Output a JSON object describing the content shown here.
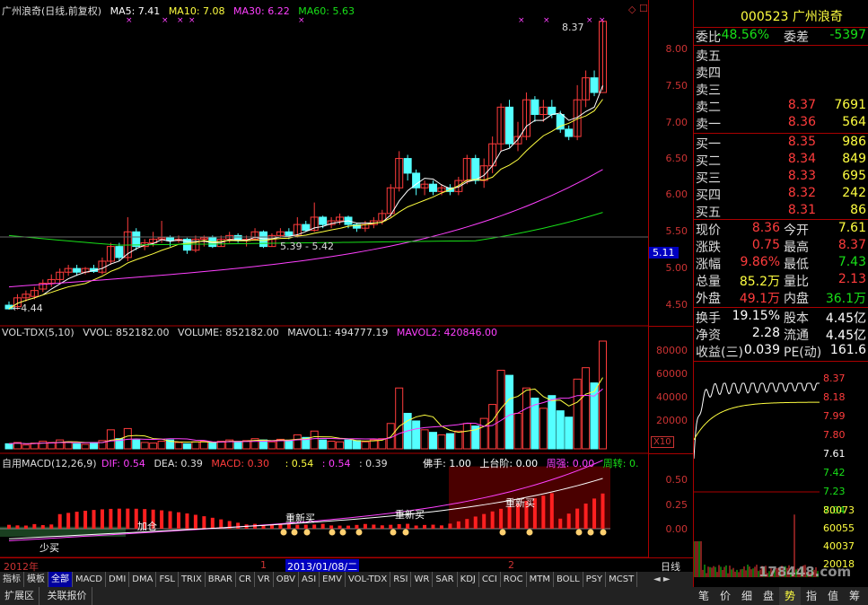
{
  "main_header": {
    "title": "广州浪奇(日线,前复权)",
    "ma5": "MA5: 7.41",
    "ma10": "MA10: 7.08",
    "ma30": "MA30: 6.22",
    "ma60": "MA60: 5.63",
    "high_label": "8.37",
    "low_label": "4.44",
    "mid_label": "5.39 - 5.42",
    "current_tag": "5.11"
  },
  "vol_header": {
    "name": "VOL-TDX(5,10)",
    "vvol": "VVOL: 852182.00",
    "volume": "VOLUME: 852182.00",
    "mavol1": "MAVOL1: 494777.19",
    "mavol2": "MAVOL2: 420846.00"
  },
  "macd_header": {
    "name": "自用MACD(12,26,9)",
    "dif": "DIF: 0.54",
    "dea": "DEA: 0.39",
    "macd": "MACD: 0.30",
    "v1": ": 0.54",
    "v2": ": 0.54",
    "v3": ": 0.39",
    "foshou": "佛手: 1.00",
    "shangtai": "上台阶: 0.00",
    "zhouqiang": "周强: 0.00",
    "zhouzhuan": "周转: 0."
  },
  "annotations": {
    "shaomai": "少买",
    "jiacang": "加仓",
    "chongxin1": "重新买",
    "chongxin2": "重新买",
    "chongxin3": "重新买",
    "x10": "X10"
  },
  "price_axis": [
    "8.00",
    "7.50",
    "7.00",
    "6.50",
    "6.00",
    "5.50",
    "5.00",
    "4.50"
  ],
  "vol_axis": [
    "80000",
    "60000",
    "40000",
    "20000"
  ],
  "macd_axis": [
    "0.50",
    "0.25",
    "0.00"
  ],
  "time_axis": {
    "year": "2012年",
    "m1": "1",
    "date": "2013/01/08/二",
    "m2": "2",
    "period": "日线"
  },
  "quote": {
    "code": "000523",
    "name": "广州浪奇",
    "weibi_label": "委比",
    "weibi": "-48.56%",
    "weicha_label": "委差",
    "weicha": "-5397",
    "sell": [
      {
        "label": "卖五",
        "price": "",
        "vol": ""
      },
      {
        "label": "卖四",
        "price": "",
        "vol": ""
      },
      {
        "label": "卖三",
        "price": "",
        "vol": ""
      },
      {
        "label": "卖二",
        "price": "8.37",
        "vol": "7691"
      },
      {
        "label": "卖一",
        "price": "8.36",
        "vol": "564"
      }
    ],
    "buy": [
      {
        "label": "买一",
        "price": "8.35",
        "vol": "986"
      },
      {
        "label": "买二",
        "price": "8.34",
        "vol": "849"
      },
      {
        "label": "买三",
        "price": "8.33",
        "vol": "695"
      },
      {
        "label": "买四",
        "price": "8.32",
        "vol": "242"
      },
      {
        "label": "买五",
        "price": "8.31",
        "vol": "86"
      }
    ],
    "stats": [
      {
        "l1": "现价",
        "v1": "8.36",
        "l2": "今开",
        "v2": "7.61"
      },
      {
        "l1": "涨跌",
        "v1": "0.75",
        "l2": "最高",
        "v2": "8.37"
      },
      {
        "l1": "涨幅",
        "v1": "9.86%",
        "l2": "最低",
        "v2": "7.43"
      },
      {
        "l1": "总量",
        "v1": "85.2万",
        "l2": "量比",
        "v2": "2.13"
      },
      {
        "l1": "外盘",
        "v1": "49.1万",
        "l2": "内盘",
        "v2": "36.1万"
      }
    ],
    "stats2": [
      {
        "l1": "换手",
        "v1": "19.15%",
        "l2": "股本",
        "v2": "4.45亿"
      },
      {
        "l1": "净资",
        "v1": "2.28",
        "l2": "流通",
        "v2": "4.45亿"
      },
      {
        "l1": "收益(三)",
        "v1": "0.039",
        "l2": "PE(动)",
        "v2": "161.6"
      }
    ]
  },
  "mini_axis": [
    "8.37",
    "8.18",
    "7.99",
    "7.80",
    "7.61",
    "7.42",
    "7.23",
    "7.04"
  ],
  "mini_vol_axis": [
    "80073",
    "60055",
    "40037",
    "20018"
  ],
  "watermark": "178448.com",
  "tabs": [
    "指标",
    "模板",
    "全部",
    "MACD",
    "DMI",
    "DMA",
    "FSL",
    "TRIX",
    "BRAR",
    "CR",
    "VR",
    "OBV",
    "ASI",
    "EMV",
    "VOL-TDX",
    "RSI",
    "WR",
    "SAR",
    "KDJ",
    "CCI",
    "ROC",
    "MTM",
    "BOLL",
    "PSY",
    "MCST"
  ],
  "bottom_tabs": [
    "扩展区",
    "关联报价"
  ],
  "right_tabs": [
    "笔",
    "价",
    "细",
    "盘",
    "势",
    "指",
    "值",
    "筹"
  ],
  "colors": {
    "up": "#ff3c3c",
    "down": "#54ffff",
    "ma5": "#ffffff",
    "ma10": "#ffff40",
    "ma30": "#ff40ff",
    "ma60": "#18e018"
  }
}
